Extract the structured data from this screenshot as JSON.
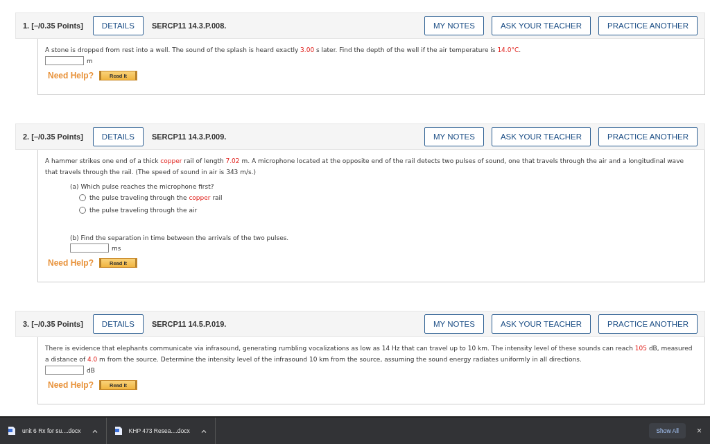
{
  "questions": [
    {
      "number": "1.",
      "points": "[–/0.35 Points]",
      "details": "DETAILS",
      "code": "SERCP11 14.3.P.008.",
      "actions": [
        "MY NOTES",
        "ASK YOUR TEACHER",
        "PRACTICE ANOTHER"
      ],
      "body": [
        {
          "kind": "paragraph",
          "segments": [
            {
              "kind": "text",
              "text": "A stone is dropped from rest into a well. The sound of the splash is heard exactly "
            },
            {
              "kind": "value",
              "text": "3.00"
            },
            {
              "kind": "text",
              "text": " s later. Find the depth of the well if the air temperature is "
            },
            {
              "kind": "value",
              "text": "14.0°C"
            },
            {
              "kind": "text",
              "text": "."
            }
          ]
        },
        {
          "kind": "answer",
          "unit": "m"
        }
      ],
      "help": {
        "label": "Need Help?",
        "button": "Read It"
      }
    },
    {
      "number": "2.",
      "points": "[–/0.35 Points]",
      "details": "DETAILS",
      "code": "SERCP11 14.3.P.009.",
      "actions": [
        "MY NOTES",
        "ASK YOUR TEACHER",
        "PRACTICE ANOTHER"
      ],
      "body": [
        {
          "kind": "paragraph",
          "segments": [
            {
              "kind": "text",
              "text": "A hammer strikes one end of a thick "
            },
            {
              "kind": "value",
              "text": "copper"
            },
            {
              "kind": "text",
              "text": " rail of length "
            },
            {
              "kind": "value",
              "text": "7.02"
            },
            {
              "kind": "text",
              "text": " m. A microphone located at the opposite end of the rail detects two pulses of sound, one that travels through the air and a longitudinal wave that travels through the rail. (The speed of sound in air is 343 m/s.)"
            }
          ]
        },
        {
          "kind": "prompt",
          "text": "(a) Which pulse reaches the microphone first?"
        },
        {
          "kind": "choice",
          "selected": false,
          "segments": [
            {
              "kind": "text",
              "text": "the pulse traveling through the "
            },
            {
              "kind": "value",
              "text": "copper"
            },
            {
              "kind": "text",
              "text": " rail"
            }
          ]
        },
        {
          "kind": "choice",
          "selected": false,
          "segments": [
            {
              "kind": "text",
              "text": "the pulse traveling through the air"
            }
          ]
        },
        {
          "kind": "prompt",
          "text": "(b) Find the separation in time between the arrivals of the two pulses."
        },
        {
          "kind": "answer",
          "unit": "ms"
        }
      ],
      "help": {
        "label": "Need Help?",
        "button": "Read It"
      }
    },
    {
      "number": "3.",
      "points": "[–/0.35 Points]",
      "details": "DETAILS",
      "code": "SERCP11 14.5.P.019.",
      "actions": [
        "MY NOTES",
        "ASK YOUR TEACHER",
        "PRACTICE ANOTHER"
      ],
      "body": [
        {
          "kind": "paragraph",
          "segments": [
            {
              "kind": "text",
              "text": "There is evidence that elephants communicate via infrasound, generating rumbling vocalizations as low as 14 Hz that can travel up to 10 km. The intensity level of these sounds can reach "
            },
            {
              "kind": "value",
              "text": "105"
            },
            {
              "kind": "text",
              "text": " dB, measured a distance of "
            },
            {
              "kind": "value",
              "text": "4.0"
            },
            {
              "kind": "text",
              "text": " m from the source. Determine the intensity level of the infrasound 10 km from the source, assuming the sound energy radiates uniformly in all directions."
            }
          ]
        },
        {
          "kind": "answer",
          "unit": "dB"
        }
      ],
      "help": {
        "label": "Need Help?",
        "button": "Read It"
      }
    }
  ],
  "downloads": {
    "items": [
      {
        "name": "unit 6 Rx for su....docx"
      },
      {
        "name": "KHP 473 Resea....docx"
      }
    ],
    "show_all": "Show All",
    "close": "×"
  }
}
